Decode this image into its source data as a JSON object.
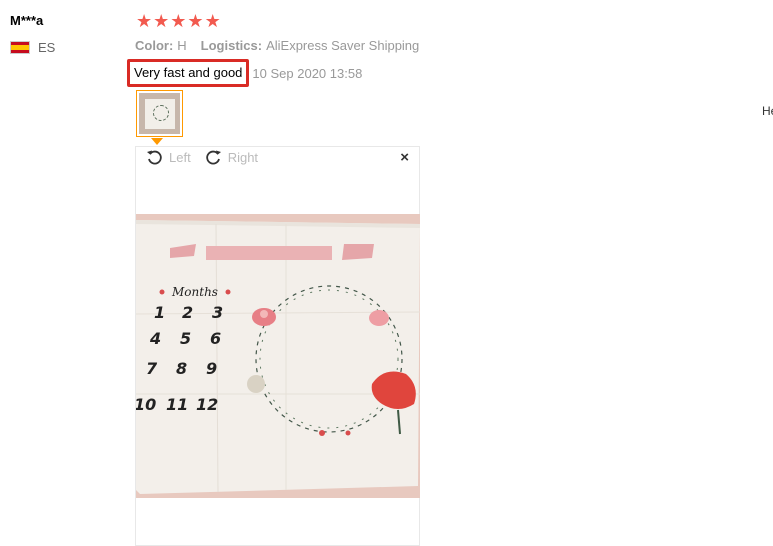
{
  "reviewer": {
    "name": "M***a",
    "country": "ES"
  },
  "rating": {
    "stars": 5,
    "star_color": "#f25a4f"
  },
  "meta": {
    "color_label": "Color:",
    "color_value": "H",
    "logistics_label": "Logistics:",
    "logistics_value": "AliExpress Saver Shipping"
  },
  "review": {
    "text": "Very fast and good",
    "date": "10 Sep 2020 13:58",
    "highlight_color": "#d92b25"
  },
  "viewer": {
    "rotate_left": "Left",
    "rotate_right": "Right",
    "close": "×"
  },
  "photo": {
    "months_label": "Months",
    "numbers": [
      "1",
      "2",
      "3",
      "4",
      "5",
      "6",
      "7",
      "8",
      "9",
      "10",
      "11",
      "12"
    ]
  },
  "cut_off_text": "He",
  "accent": "#ff9900"
}
